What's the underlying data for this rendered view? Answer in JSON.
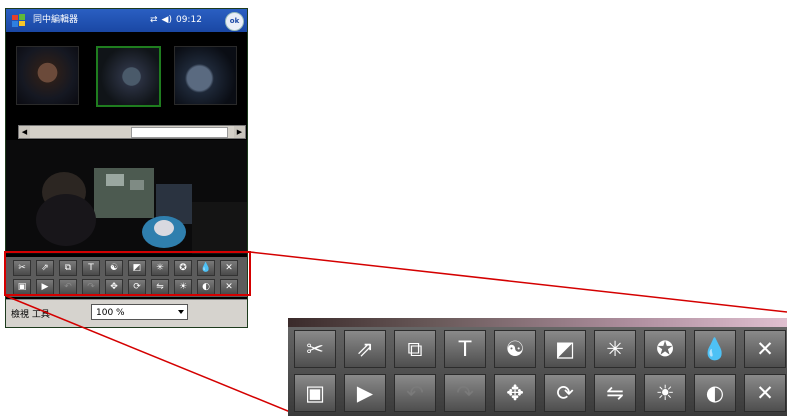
{
  "app": {
    "title": "同中編輯器",
    "sync_icon": "sync-arrows-icon",
    "volume_icon": "speaker-icon",
    "time": "09:12",
    "ok_label": "ok"
  },
  "zoom": {
    "label": "檢視 工具",
    "value": "100 %"
  },
  "toolbar": {
    "row1": [
      {
        "name": "scissors-icon",
        "glyph": "✂",
        "enabled": true
      },
      {
        "name": "export-icon",
        "glyph": "⇗",
        "enabled": true
      },
      {
        "name": "transition-icon",
        "glyph": "⧉",
        "enabled": true
      },
      {
        "name": "text-icon",
        "glyph": "T",
        "enabled": true
      },
      {
        "name": "color-effect-icon",
        "glyph": "☯",
        "enabled": true
      },
      {
        "name": "picture-in-picture-icon",
        "glyph": "◩",
        "enabled": true
      },
      {
        "name": "sparkle-icon",
        "glyph": "✳",
        "enabled": true
      },
      {
        "name": "star-badge-icon",
        "glyph": "✪",
        "enabled": true
      },
      {
        "name": "water-drop-icon",
        "glyph": "💧",
        "enabled": true
      },
      {
        "name": "close-icon",
        "glyph": "✕",
        "enabled": true
      }
    ],
    "row2": [
      {
        "name": "frame-capture-icon",
        "glyph": "▣",
        "enabled": true
      },
      {
        "name": "play-clip-icon",
        "glyph": "▶",
        "enabled": true
      },
      {
        "name": "rotate-left-icon",
        "glyph": "↶",
        "enabled": false
      },
      {
        "name": "rotate-right-icon",
        "glyph": "↷",
        "enabled": false
      },
      {
        "name": "move-icon",
        "glyph": "✥",
        "enabled": true
      },
      {
        "name": "rotate-free-icon",
        "glyph": "⟳",
        "enabled": true
      },
      {
        "name": "flip-icon",
        "glyph": "⇋",
        "enabled": true
      },
      {
        "name": "brightness-icon",
        "glyph": "☀",
        "enabled": true
      },
      {
        "name": "contrast-icon",
        "glyph": "◐",
        "enabled": true
      },
      {
        "name": "delete-icon",
        "glyph": "✕",
        "enabled": true
      }
    ]
  },
  "colors": {
    "titlebar": "#1f52b5",
    "callout": "#d40000",
    "selected_thumb": "#1f7d1f"
  }
}
